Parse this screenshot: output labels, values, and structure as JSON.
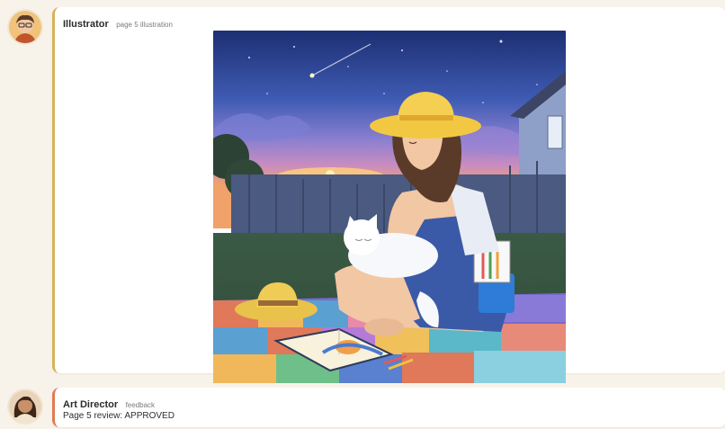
{
  "messages": [
    {
      "sender": "Illustrator",
      "tag": "page 5 illustration",
      "attachment": {
        "kind": "illustration",
        "icon": "illustrator-avatar"
      }
    },
    {
      "sender": "Art Director",
      "tag": "feedback",
      "text": "Page 5 review: APPROVED"
    }
  ],
  "colors": {
    "page_bg": "#f8f3ea",
    "illustrator_accent": "#d8b25a",
    "director_accent": "#e27b53"
  }
}
